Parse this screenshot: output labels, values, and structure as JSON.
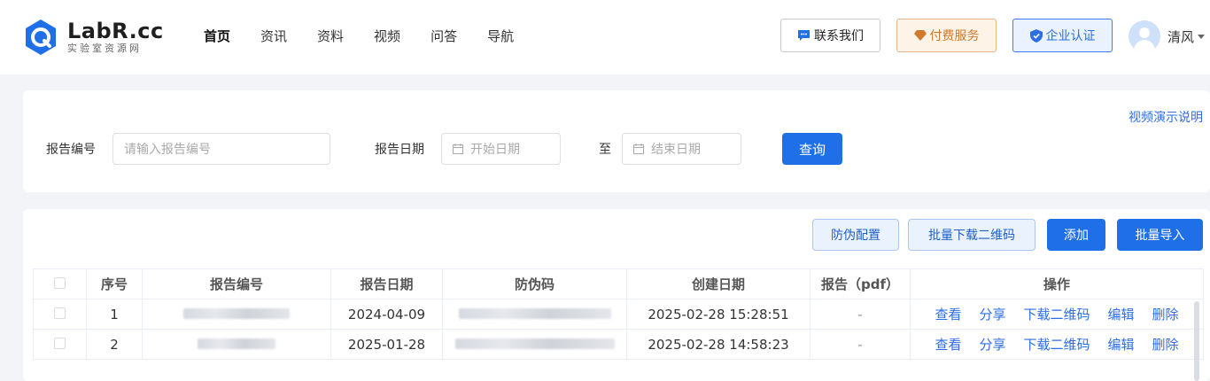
{
  "header": {
    "logo_name": "LabR.cc",
    "logo_sub": "实验室资源网",
    "nav": [
      {
        "label": "首页",
        "active": true
      },
      {
        "label": "资讯",
        "active": false
      },
      {
        "label": "资料",
        "active": false
      },
      {
        "label": "视频",
        "active": false
      },
      {
        "label": "问答",
        "active": false
      },
      {
        "label": "导航",
        "active": false
      }
    ],
    "contact_label": "联系我们",
    "pay_label": "付费服务",
    "cert_label": "企业认证",
    "user_name": "清风"
  },
  "search": {
    "help_link": "视频演示说明",
    "report_no_label": "报告编号",
    "report_no_placeholder": "请输入报告编号",
    "report_date_label": "报告日期",
    "start_placeholder": "开始日期",
    "to_label": "至",
    "end_placeholder": "结束日期",
    "query_label": "查询"
  },
  "toolbar": {
    "anti_fake_config": "防伪配置",
    "batch_download_qr": "批量下载二维码",
    "add": "添加",
    "batch_import": "批量导入"
  },
  "table": {
    "columns": [
      "序号",
      "报告编号",
      "报告日期",
      "防伪码",
      "创建日期",
      "报告（pdf）",
      "操作"
    ],
    "rows": [
      {
        "index": "1",
        "report_date": "2024-04-09",
        "created": "2025-02-28 15:28:51",
        "pdf": "-"
      },
      {
        "index": "2",
        "report_date": "2025-01-28",
        "created": "2025-02-28 14:58:23",
        "pdf": "-"
      }
    ],
    "ops": [
      "查看",
      "分享",
      "下载二维码",
      "编辑",
      "删除"
    ]
  },
  "colors": {
    "primary": "#1f6fe8",
    "link": "#2d6ee6",
    "pay": "#d07a2c"
  }
}
